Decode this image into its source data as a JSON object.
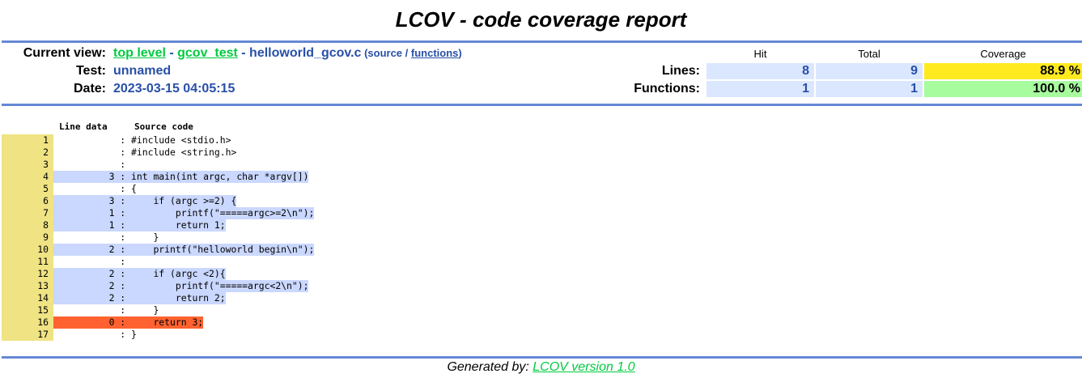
{
  "title": "LCOV - code coverage report",
  "header": {
    "current_view_label": "Current view:",
    "crumb_top": "top level",
    "crumb_sep1": " - ",
    "crumb_dir": "gcov_test",
    "crumb_sep2": " - ",
    "crumb_file": "helloworld_gcov.c",
    "source_open": " (source / ",
    "functions_link": "functions",
    "source_close": ")",
    "test_label": "Test:",
    "test_value": "unnamed",
    "date_label": "Date:",
    "date_value": "2023-03-15 04:05:15"
  },
  "stats": {
    "col_hit": "Hit",
    "col_total": "Total",
    "col_coverage": "Coverage",
    "lines_label": "Lines:",
    "lines_hit": "8",
    "lines_total": "9",
    "lines_cov": "88.9 %",
    "functions_label": "Functions:",
    "functions_hit": "1",
    "functions_total": "1",
    "functions_cov": "100.0 %"
  },
  "source": {
    "col_line_data": "Line data",
    "col_source_code": "Source code",
    "lines": [
      {
        "n": "1",
        "count": "",
        "code": "#include <stdio.h>",
        "state": "none"
      },
      {
        "n": "2",
        "count": "",
        "code": "#include <string.h>",
        "state": "none"
      },
      {
        "n": "3",
        "count": "",
        "code": "",
        "state": "none"
      },
      {
        "n": "4",
        "count": "3",
        "code": "int main(int argc, char *argv[])",
        "state": "hit"
      },
      {
        "n": "5",
        "count": "",
        "code": "{",
        "state": "none"
      },
      {
        "n": "6",
        "count": "3",
        "code": "    if (argc >=2) {",
        "state": "hit"
      },
      {
        "n": "7",
        "count": "1",
        "code": "        printf(\"=====argc>=2\\n\");",
        "state": "hit"
      },
      {
        "n": "8",
        "count": "1",
        "code": "        return 1;",
        "state": "hit"
      },
      {
        "n": "9",
        "count": "",
        "code": "    }",
        "state": "none"
      },
      {
        "n": "10",
        "count": "2",
        "code": "    printf(\"helloworld begin\\n\");",
        "state": "hit"
      },
      {
        "n": "11",
        "count": "",
        "code": "",
        "state": "none"
      },
      {
        "n": "12",
        "count": "2",
        "code": "    if (argc <2){",
        "state": "hit"
      },
      {
        "n": "13",
        "count": "2",
        "code": "        printf(\"=====argc<2\\n\");",
        "state": "hit"
      },
      {
        "n": "14",
        "count": "2",
        "code": "        return 2;",
        "state": "hit"
      },
      {
        "n": "15",
        "count": "",
        "code": "    }",
        "state": "none"
      },
      {
        "n": "16",
        "count": "0",
        "code": "    return 3;",
        "state": "miss"
      },
      {
        "n": "17",
        "count": "",
        "code": "}",
        "state": "none"
      }
    ]
  },
  "footer": {
    "generated_by": "Generated by: ",
    "lcov_link": "LCOV version 1.0"
  },
  "colors": {
    "ruler": "#6688d4",
    "hit_bg": "#cad7fe",
    "miss_bg": "#ff6230",
    "line_num_bg": "#efe383",
    "cov_medium": "#ffea20",
    "cov_high": "#a7fc9d",
    "stat_bg": "#dae7fe",
    "link_green": "#00cb40",
    "value_blue": "#284fa8"
  }
}
